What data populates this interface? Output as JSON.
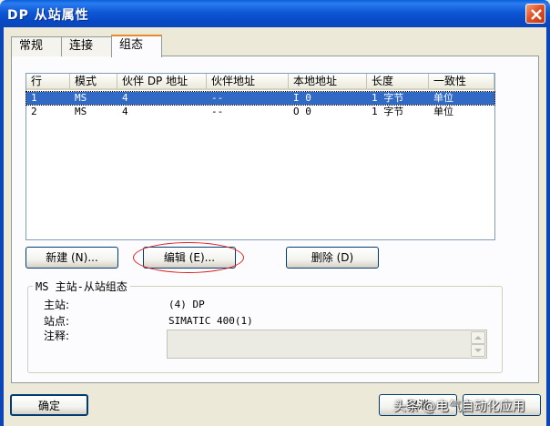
{
  "window": {
    "title": "DP 从站属性"
  },
  "tabs": [
    {
      "label": "常规"
    },
    {
      "label": "连接"
    },
    {
      "label": "组态"
    }
  ],
  "table": {
    "columns": [
      "行",
      "模式",
      "伙伴 DP 地址",
      "伙伴地址",
      "本地地址",
      "长度",
      "一致性"
    ],
    "rows": [
      {
        "row": "1",
        "mode": "MS",
        "partner_dp": "4",
        "partner_addr": "--",
        "local_addr": "I 0",
        "length": "1 字节",
        "consistency": "单位",
        "selected": true
      },
      {
        "row": "2",
        "mode": "MS",
        "partner_dp": "4",
        "partner_addr": "--",
        "local_addr": "O 0",
        "length": "1 字节",
        "consistency": "单位",
        "selected": false
      }
    ]
  },
  "buttons": {
    "new": "新建 (N)...",
    "edit": "编辑 (E)...",
    "delete": "删除 (D)",
    "ok": "确定",
    "cancel": "取消"
  },
  "group": {
    "legend": "MS 主站-从站组态",
    "master_label": "主站:",
    "master_value": "(4) DP",
    "station_label": "站点:",
    "station_value": "SIMATIC 400(1)",
    "comment_label": "注释:",
    "comment_value": ""
  },
  "watermark": "头条 @电气自动化应用",
  "colors": {
    "title_bar": "#0a5fd8",
    "selection": "#316ac5",
    "highlight_ellipse": "#e02020",
    "dialog_bg": "#ece9d8"
  }
}
